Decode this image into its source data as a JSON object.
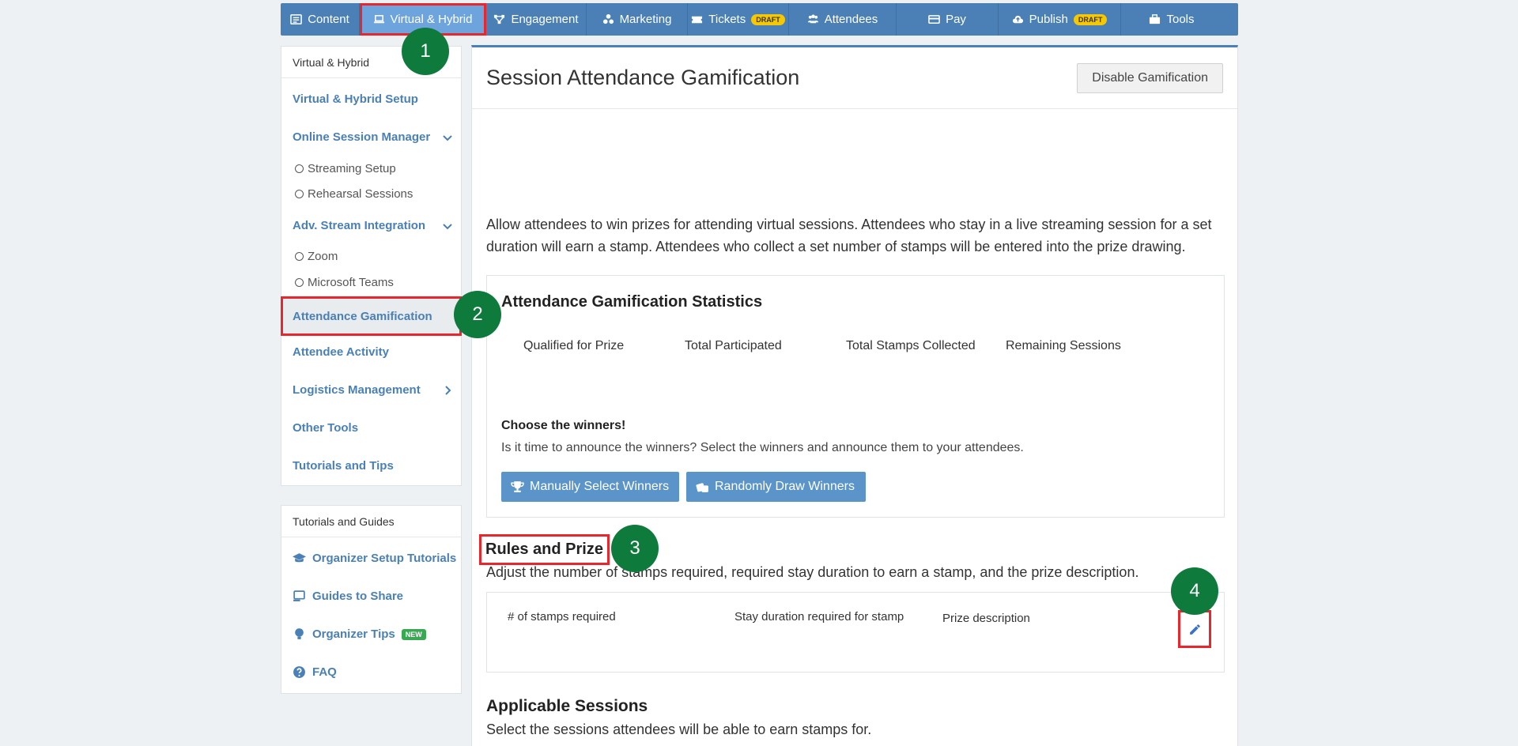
{
  "topnav": {
    "tabs": [
      {
        "label": "Content",
        "icon": "list-icon"
      },
      {
        "label": "Virtual & Hybrid",
        "icon": "laptop-icon",
        "active": true
      },
      {
        "label": "Engagement",
        "icon": "network-icon"
      },
      {
        "label": "Marketing",
        "icon": "share-icon"
      },
      {
        "label": "Tickets",
        "icon": "ticket-icon",
        "badge": "DRAFT"
      },
      {
        "label": "Attendees",
        "icon": "users-icon"
      },
      {
        "label": "Pay",
        "icon": "credit-card-icon"
      },
      {
        "label": "Publish",
        "icon": "cloud-upload-icon",
        "badge": "DRAFT"
      },
      {
        "label": "Tools",
        "icon": "toolbox-icon"
      }
    ]
  },
  "sidebar": {
    "heading": "Virtual & Hybrid",
    "setup": "Virtual & Hybrid Setup",
    "session_manager": "Online Session Manager",
    "streaming_setup": "Streaming Setup",
    "rehearsal": "Rehearsal Sessions",
    "stream_integration": "Adv. Stream Integration",
    "zoom": "Zoom",
    "teams": "Microsoft Teams",
    "gamification": "Attendance Gamification",
    "activity": "Attendee Activity",
    "logistics": "Logistics Management",
    "other_tools": "Other Tools",
    "tutorials": "Tutorials and Tips"
  },
  "guides": {
    "heading": "Tutorials and Guides",
    "setup_tutorials": "Organizer Setup Tutorials",
    "guides_share": "Guides to Share",
    "organizer_tips": "Organizer Tips",
    "new_badge": "NEW",
    "faq": "FAQ"
  },
  "main": {
    "title": "Session Attendance Gamification",
    "disable_button": "Disable Gamification",
    "intro": "Allow attendees to win prizes for attending virtual sessions. Attendees who stay in a live streaming session for a set duration will earn a stamp. Attendees who collect a set number of stamps will be entered into the prize drawing.",
    "stats": {
      "title": "Attendance Gamification Statistics",
      "qualified": "Qualified for Prize",
      "participated": "Total Participated",
      "stamps": "Total Stamps Collected",
      "remaining": "Remaining Sessions"
    },
    "choose": {
      "title": "Choose the winners!",
      "desc": "Is it time to announce the winners? Select the winners and announce them to your attendees.",
      "manual_button": "Manually Select Winners",
      "random_button": "Randomly Draw Winners"
    },
    "rules": {
      "title": "Rules and Prize",
      "desc": "Adjust the number of stamps required, required stay duration to earn a stamp, and the prize description.",
      "col_stamps": "# of stamps required",
      "col_duration": "Stay duration required for stamp",
      "col_prize": "Prize description"
    },
    "sessions": {
      "title": "Applicable Sessions",
      "desc": "Select the sessions attendees will be able to earn stamps for."
    }
  },
  "markers": [
    "1",
    "2",
    "3",
    "4"
  ],
  "colors": {
    "nav": "#4a80b5",
    "highlight": "#e8262b",
    "marker": "#0e7a3c",
    "draft": "#f6c800",
    "new": "#38a852"
  }
}
